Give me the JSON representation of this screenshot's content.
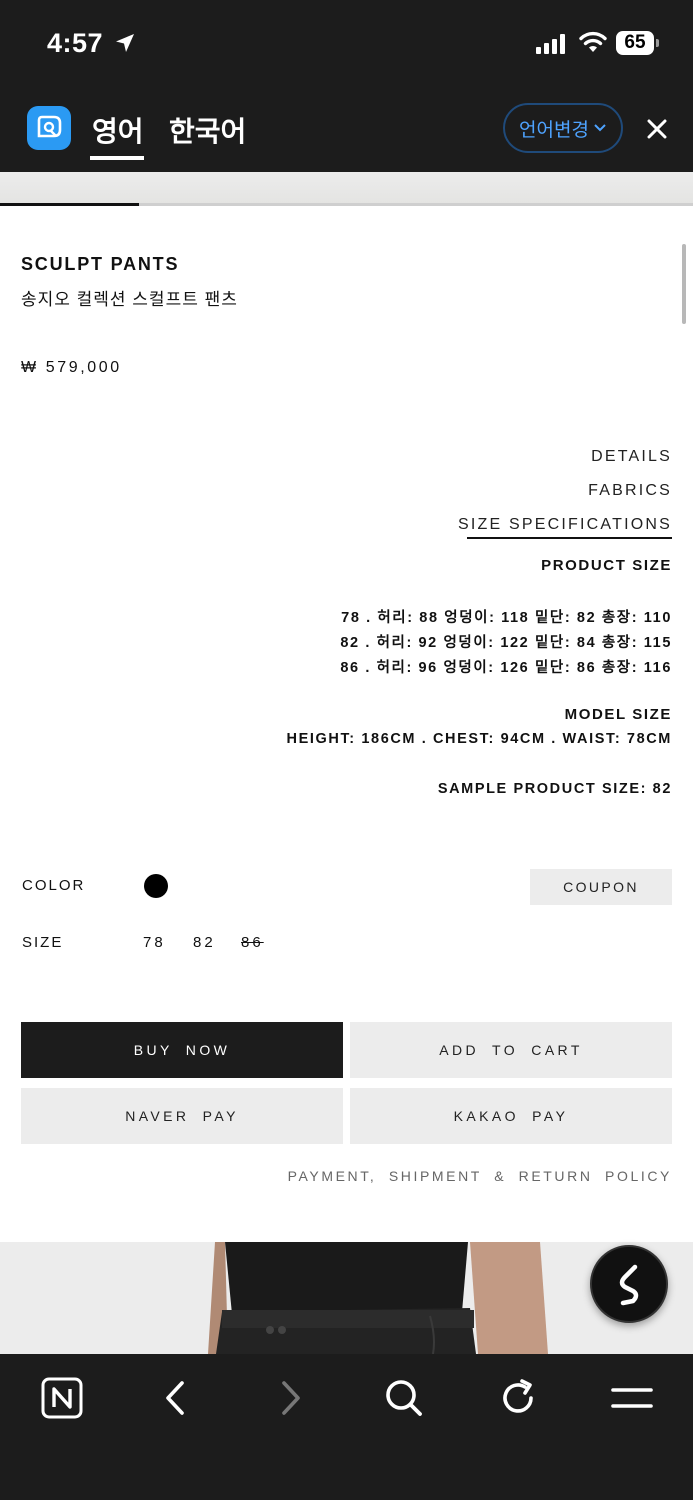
{
  "status_bar": {
    "time": "4:57",
    "battery": "65"
  },
  "translate_bar": {
    "source_lang": "영어",
    "target_lang": "한국어",
    "change_label": "언어변경",
    "change_chevron": "⌄"
  },
  "gallery": {
    "progress": 0.2
  },
  "product": {
    "name_en": "SCULPT PANTS",
    "name_ko": "송지오 컬렉션 스컬프트 팬츠",
    "price": "₩ 579,000"
  },
  "info_menu": [
    "DETAILS",
    "FABRICS",
    "SIZE SPECIFICATIONS"
  ],
  "size_spec": {
    "product_size_heading": "PRODUCT SIZE",
    "rows": [
      "78 . 허리: 88 엉덩이: 118  밑단: 82 총장: 110",
      "82 . 허리: 92 엉덩이: 122 밑단: 84 총장: 115",
      "86 . 허리: 96 엉덩이: 126 밑단: 86 총장: 116"
    ],
    "model_size_heading": "MODEL SIZE",
    "model_size": "HEIGHT: 186CM . CHEST: 94CM . WAIST: 78CM",
    "sample_size": "SAMPLE PRODUCT SIZE: 82"
  },
  "options": {
    "color_label": "COLOR",
    "size_label": "SIZE",
    "sizes": [
      "78",
      "82",
      "86"
    ],
    "sold_out_size": "86",
    "coupon_label": "COUPON"
  },
  "actions": {
    "buy_now": "BUY NOW",
    "add_to_cart": "ADD TO CART",
    "naver_pay": "NAVER PAY",
    "kakao_pay": "KAKAO PAY",
    "policy_link": "PAYMENT, SHIPMENT & RETURN POLICY"
  },
  "icons": {
    "status": [
      "location-arrow-icon",
      "cellular-signal-icon",
      "wifi-icon",
      "battery-icon"
    ],
    "bottom_nav": [
      "naver-home-icon",
      "back-icon",
      "forward-icon",
      "search-icon",
      "refresh-icon",
      "menu-icon"
    ],
    "floating": "chat-s-icon"
  }
}
